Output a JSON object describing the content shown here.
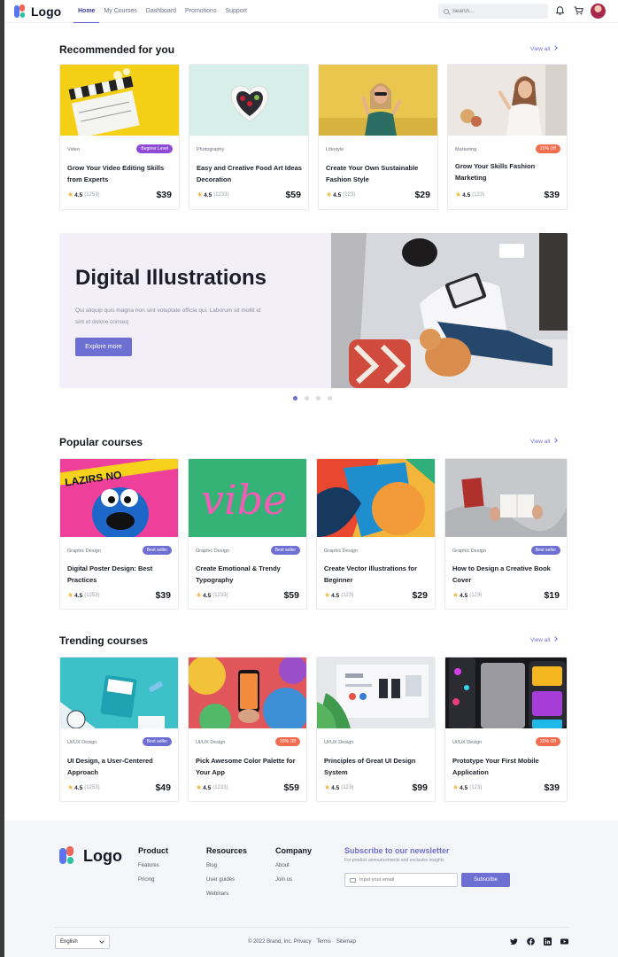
{
  "brand": {
    "logo_text": "Logo"
  },
  "nav": {
    "items": [
      {
        "label": "Home",
        "active": true
      },
      {
        "label": "My Courses"
      },
      {
        "label": "Dashboard"
      },
      {
        "label": "Promotions"
      },
      {
        "label": "Support"
      }
    ],
    "search_placeholder": "Search...",
    "icons": [
      "bell-icon",
      "cart-icon",
      "avatar"
    ]
  },
  "recommended": {
    "title": "Recommended for you",
    "view_all": "View all",
    "cards": [
      {
        "category": "Video",
        "badge": "Beginer Level",
        "badge_color": "#8e4bd6",
        "title": "Grow Your Video Editing Skills from Experts",
        "rating": "4.5",
        "count": "(1253)",
        "price": "$39"
      },
      {
        "category": "Photography",
        "badge": "",
        "title": "Easy and Creative Food Art Ideas Decoration",
        "rating": "4.5",
        "count": "(1233)",
        "price": "$59"
      },
      {
        "category": "Lifestyle",
        "badge": "",
        "title": "Create Your Own Sustainable Fashion Style",
        "rating": "4.5",
        "count": "(123)",
        "price": "$29"
      },
      {
        "category": "Marketing",
        "badge": "20% Off",
        "badge_color": "#f26d4f",
        "title": "Grow Your Skills Fashion Marketing",
        "rating": "4.5",
        "count": "(123)",
        "price": "$39"
      }
    ]
  },
  "hero": {
    "title": "Digital Illustrations",
    "description": "Qui aliquip quis magna non sint voluptate officia qui. Laborum sit mollit id sint et dolore conseq",
    "button": "Explore more",
    "slides": 4,
    "active_slide": 1
  },
  "popular": {
    "title": "Popular courses",
    "view_all": "View all",
    "cards": [
      {
        "category": "Graphic Design",
        "badge": "Best seller",
        "badge_color": "#6e6fd3",
        "title": "Digital Poster Design: Best Practices",
        "rating": "4.5",
        "count": "(1253)",
        "price": "$39"
      },
      {
        "category": "Graphic Design",
        "badge": "Best seller",
        "badge_color": "#6e6fd3",
        "title": "Create Emotional & Trendy Typography",
        "rating": "4.5",
        "count": "(1233)",
        "price": "$59"
      },
      {
        "category": "Graphic Design",
        "badge": "",
        "title": "Create Vector Illustrations for Beginner",
        "rating": "4.5",
        "count": "(123)",
        "price": "$29"
      },
      {
        "category": "Graphic Design",
        "badge": "Best seller",
        "badge_color": "#6e6fd3",
        "title": "How to Design a Creative Book Cover",
        "rating": "4.5",
        "count": "(123)",
        "price": "$19"
      }
    ]
  },
  "trending": {
    "title": "Trending courses",
    "view_all": "View all",
    "cards": [
      {
        "category": "UI/UX Design",
        "badge": "Best seller",
        "badge_color": "#6e6fd3",
        "title": "UI Design, a User-Centered Approach",
        "rating": "4.5",
        "count": "(1253)",
        "price": "$49"
      },
      {
        "category": "UI/UX Design",
        "badge": "20% Off",
        "badge_color": "#f26d4f",
        "title": "Pick Awesome Color Palette for Your App",
        "rating": "4.5",
        "count": "(1233)",
        "price": "$59"
      },
      {
        "category": "UI/UX Design",
        "badge": "",
        "title": "Principles of Great UI Design System",
        "rating": "4.5",
        "count": "(123)",
        "price": "$99"
      },
      {
        "category": "UI/UX Design",
        "badge": "20% Off",
        "badge_color": "#f26d4f",
        "title": "Prototype Your First Mobile Application",
        "rating": "4.5",
        "count": "(123)",
        "price": "$39"
      }
    ]
  },
  "footer": {
    "logo_text": "Logo",
    "product": {
      "title": "Product",
      "links": [
        "Features",
        "Pricing"
      ]
    },
    "resources": {
      "title": "Resources",
      "links": [
        "Blog",
        "User guides",
        "Webinars"
      ]
    },
    "company": {
      "title": "Company",
      "links": [
        "About",
        "Join us"
      ]
    },
    "newsletter": {
      "title": "Subscribe to our newsletter",
      "subtitle": "For product announcements and exclusive insights",
      "placeholder": "Input your email",
      "button": "Subscribe"
    },
    "language": "English",
    "copyright": "© 2022 Brand, Inc.",
    "legal_links": [
      "Privacy",
      "Terms",
      "Sitemap"
    ],
    "socials": [
      "twitter-icon",
      "facebook-icon",
      "linkedin-icon",
      "youtube-icon"
    ]
  },
  "colors": {
    "accent": "#6e6fd3",
    "hero_bg": "#f2eff8",
    "star": "#f5b83b",
    "offer": "#f26d4f",
    "level": "#8e4bd6"
  }
}
